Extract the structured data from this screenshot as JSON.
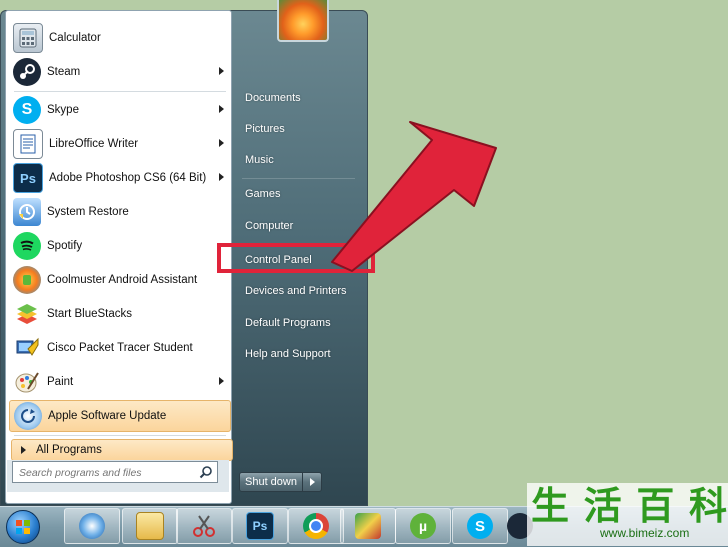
{
  "programs": [
    {
      "label": "Calculator",
      "icon": "calculator-icon",
      "has_arrow": false
    },
    {
      "label": "Steam",
      "icon": "steam-icon",
      "has_arrow": true
    },
    {
      "label": "Skype",
      "icon": "skype-icon",
      "has_arrow": true
    },
    {
      "label": "LibreOffice Writer",
      "icon": "libreoffice-writer-icon",
      "has_arrow": true
    },
    {
      "label": "Adobe Photoshop CS6 (64 Bit)",
      "icon": "photoshop-icon",
      "has_arrow": true
    },
    {
      "label": "System Restore",
      "icon": "system-restore-icon",
      "has_arrow": false
    },
    {
      "label": "Spotify",
      "icon": "spotify-icon",
      "has_arrow": false
    },
    {
      "label": "Coolmuster Android Assistant",
      "icon": "coolmuster-icon",
      "has_arrow": false
    },
    {
      "label": "Start BlueStacks",
      "icon": "bluestacks-icon",
      "has_arrow": false
    },
    {
      "label": "Cisco Packet Tracer Student",
      "icon": "cisco-packet-tracer-icon",
      "has_arrow": false
    },
    {
      "label": "Paint",
      "icon": "paint-icon",
      "has_arrow": true
    },
    {
      "label": "Apple Software Update",
      "icon": "apple-software-update-icon",
      "has_arrow": false,
      "highlighted": true
    }
  ],
  "all_programs_label": "All Programs",
  "search": {
    "placeholder": "Search programs and files"
  },
  "right_items": [
    "Documents",
    "Pictures",
    "Music",
    "Games",
    "Computer",
    "Control Panel",
    "Devices and Printers",
    "Default Programs",
    "Help and Support"
  ],
  "shutdown_label": "Shut down",
  "watermark": {
    "chars": [
      "生",
      "活",
      "百",
      "科"
    ],
    "url": "www.bimeiz.com"
  },
  "taskbar_icons": [
    "windows-start-icon",
    "network-icon",
    "file-explorer-icon",
    "snipping-tool-icon",
    "photoshop-icon",
    "chrome-icon",
    "picture-manager-icon",
    "utorrent-icon",
    "skype-icon",
    "steam-icon"
  ],
  "colors": {
    "highlight": "#fbd59c",
    "annotation": "#e0233a",
    "desktop": "#b5cca5"
  }
}
